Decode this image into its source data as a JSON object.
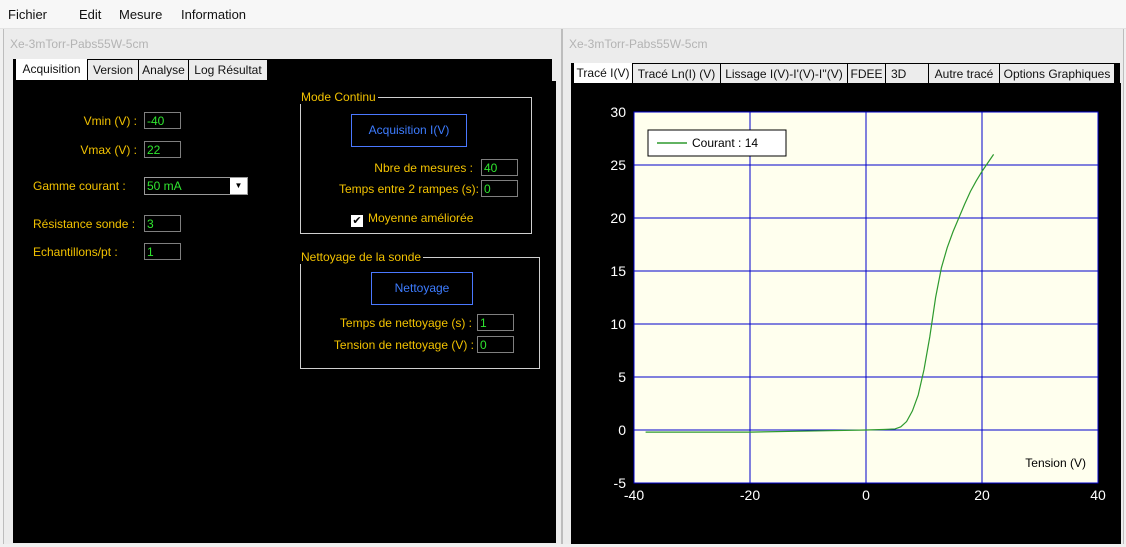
{
  "menu": [
    "Fichier",
    "Edit",
    "Mesure",
    "Information"
  ],
  "left": {
    "title": "Xe-3mTorr-Pabs55W-5cm",
    "tabs": [
      "Acquisition",
      "Version",
      "Analyse",
      "Log Résultat"
    ],
    "active_tab": 0,
    "fields": {
      "vmin": {
        "label": "Vmin (V) :",
        "value": "-40"
      },
      "vmax": {
        "label": "Vmax (V) :",
        "value": "22"
      },
      "gamme": {
        "label": "Gamme courant :",
        "value": "50 mA"
      },
      "resistance": {
        "label": "Résistance sonde :",
        "value": "3"
      },
      "echantillons": {
        "label": "Echantillons/pt :",
        "value": "1"
      }
    },
    "mode_continu": {
      "title": "Mode Continu",
      "button": "Acquisition I(V)",
      "nbre_label": "Nbre de mesures :",
      "nbre_value": "40",
      "temps_label": "Temps entre 2 rampes (s):",
      "temps_value": "0",
      "checkbox_label": "Moyenne améliorée",
      "checkbox_checked": true
    },
    "nettoyage": {
      "title": "Nettoyage de la sonde",
      "button": "Nettoyage",
      "temps_label": "Temps de nettoyage (s) :",
      "temps_value": "1",
      "tension_label": "Tension de nettoyage (V) :",
      "tension_value": "0"
    }
  },
  "right": {
    "title": "Xe-3mTorr-Pabs55W-5cm",
    "tabs": [
      "Tracé I(V)",
      "Tracé Ln(I) (V)",
      "Lissage I(V)-I'(V)-I''(V)",
      "FDEE",
      "3D",
      "Autre tracé",
      "Options Graphiques"
    ],
    "active_tab": 0
  },
  "chart_data": {
    "type": "line",
    "title": "",
    "xlabel": "Tension (V)",
    "ylabel": "",
    "xlim": [
      -40,
      40
    ],
    "ylim": [
      -5,
      30
    ],
    "xticks": [
      "-40",
      "-20",
      "0",
      "20",
      "40"
    ],
    "yticks": [
      "-5",
      "0",
      "5",
      "10",
      "15",
      "20",
      "25",
      "30"
    ],
    "grid": true,
    "legend_position": "top-left",
    "background": "#ffffee",
    "grid_color": "#0000cc",
    "series": [
      {
        "name": "Courant : 14",
        "color": "#2e9a2e",
        "x": [
          -38,
          -30,
          -20,
          -10,
          0,
          3,
          5,
          6,
          7,
          8,
          9,
          10,
          11,
          12,
          13,
          14,
          15,
          16,
          17,
          18,
          19,
          20,
          21,
          22
        ],
        "y": [
          -0.2,
          -0.2,
          -0.2,
          -0.1,
          0,
          0.05,
          0.1,
          0.3,
          0.8,
          1.8,
          3.3,
          5.7,
          8.8,
          12.5,
          15.3,
          17.2,
          18.7,
          20.0,
          21.3,
          22.5,
          23.5,
          24.4,
          25.2,
          26.0
        ]
      }
    ]
  }
}
